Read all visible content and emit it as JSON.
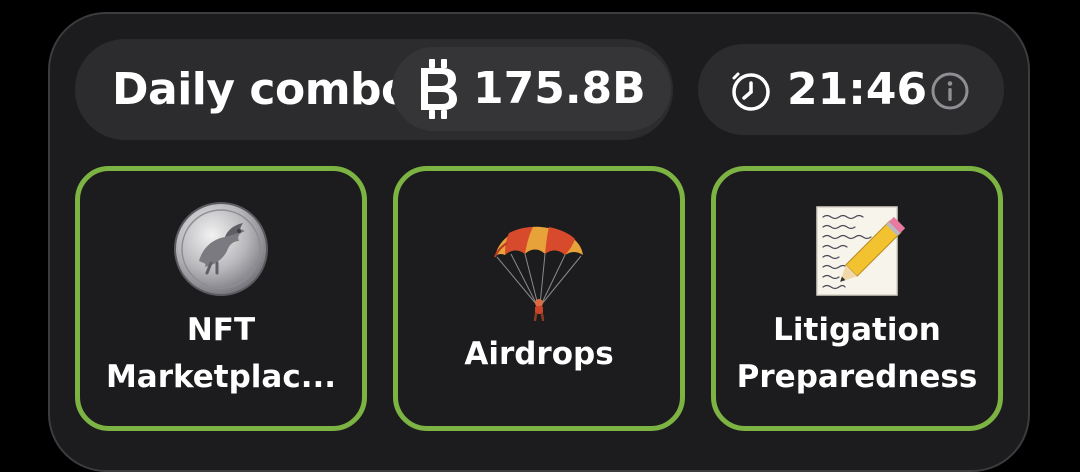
{
  "daily_combo": {
    "title": "Daily combo",
    "reward": "175.8B",
    "reward_icon": "coin-icon",
    "timer": "21:46",
    "timer_icon": "clock-icon",
    "info_icon": "info-icon"
  },
  "cards": [
    {
      "line1": "NFT",
      "line2": "Marketplac...",
      "image": "coin-image"
    },
    {
      "line1": "Airdrops",
      "line2": "",
      "image": "parachute-image"
    },
    {
      "line1": "Litigation",
      "line2": "Preparedness",
      "image": "memo-image"
    }
  ],
  "colors": {
    "card_border": "#7cb342",
    "panel": "#1c1c1e",
    "pill": "#2c2c2e"
  }
}
